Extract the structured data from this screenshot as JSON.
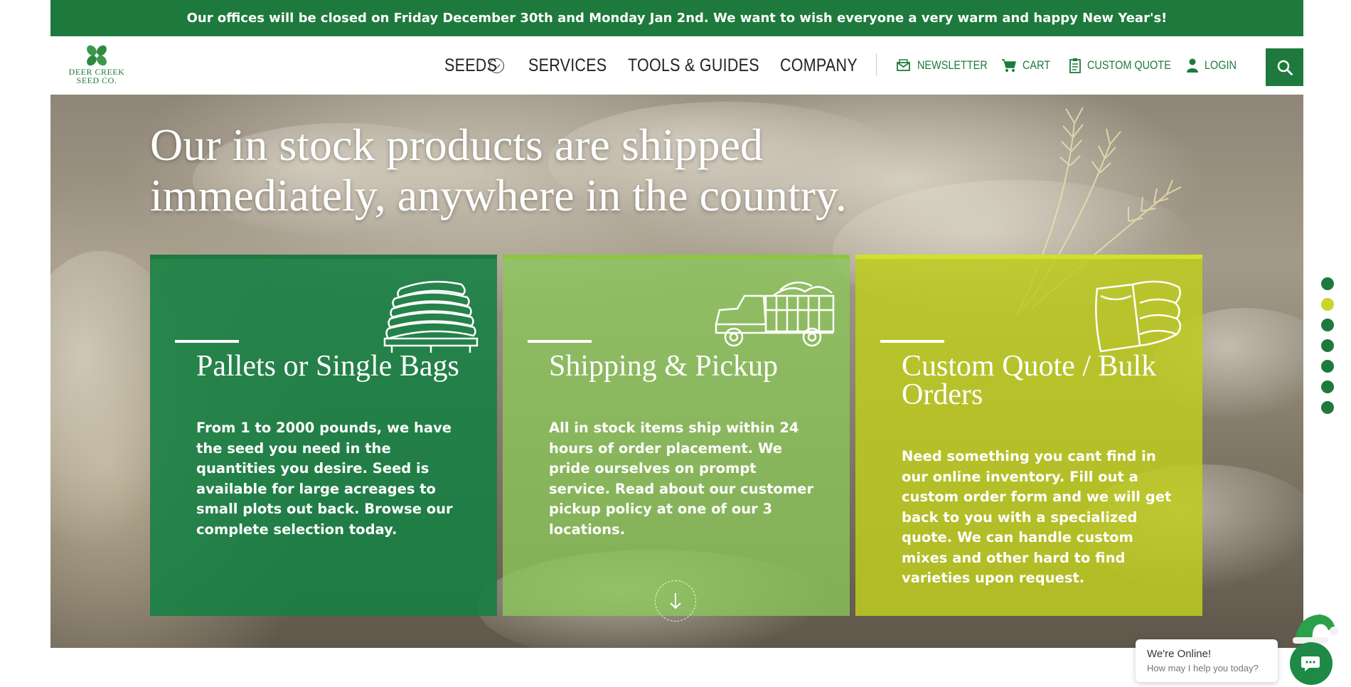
{
  "announcement": "Our offices will be closed on Friday December 30th and Monday Jan 2nd. We want to wish everyone a very warm and happy New Year's!",
  "logo": {
    "line1": "Deer Creek",
    "line2": "Seed Co.",
    "icon": "four-leaf-logo-icon"
  },
  "nav": {
    "seeds": "SEEDS",
    "services": "SERVICES",
    "tools": "TOOLS & GUIDES",
    "company": "COMPANY"
  },
  "utility": {
    "newsletter": "NEWSLETTER",
    "cart": "CART",
    "custom_quote": "CUSTOM QUOTE",
    "login": "LOGIN"
  },
  "hero": {
    "title_line1": "Our in stock products are shipped",
    "title_line2": "immediately, anywhere in the country."
  },
  "cards": [
    {
      "title": "Pallets or Single Bags",
      "body": "From 1 to 2000 pounds, we have the seed you need in the quantities you desire. Seed is available for large acreages to small plots out back. Browse our complete selection today.",
      "icon": "stacked-bags-pallet-icon"
    },
    {
      "title": "Shipping & Pickup",
      "body": "All in stock items ship within 24 hours of order placement. We pride ourselves on prompt service. Read about our customer pickup policy at one of our 3 locations.",
      "icon": "truck-icon"
    },
    {
      "title": "Custom Quote / Bulk Orders",
      "body": "Need something you cant find in our online inventory. Fill out a custom order form and we will get back to you with a specialized quote. We can handle custom mixes and other hard to find varieties upon request.",
      "icon": "seed-bags-icon"
    }
  ],
  "slide_dots": {
    "count": 7,
    "active_index": 1
  },
  "chat": {
    "title": "We're Online!",
    "subtitle": "How may I help you today?"
  },
  "colors": {
    "brand_green": "#1e7a3c",
    "light_green": "#8dc63f",
    "lime": "#c7d62a"
  }
}
